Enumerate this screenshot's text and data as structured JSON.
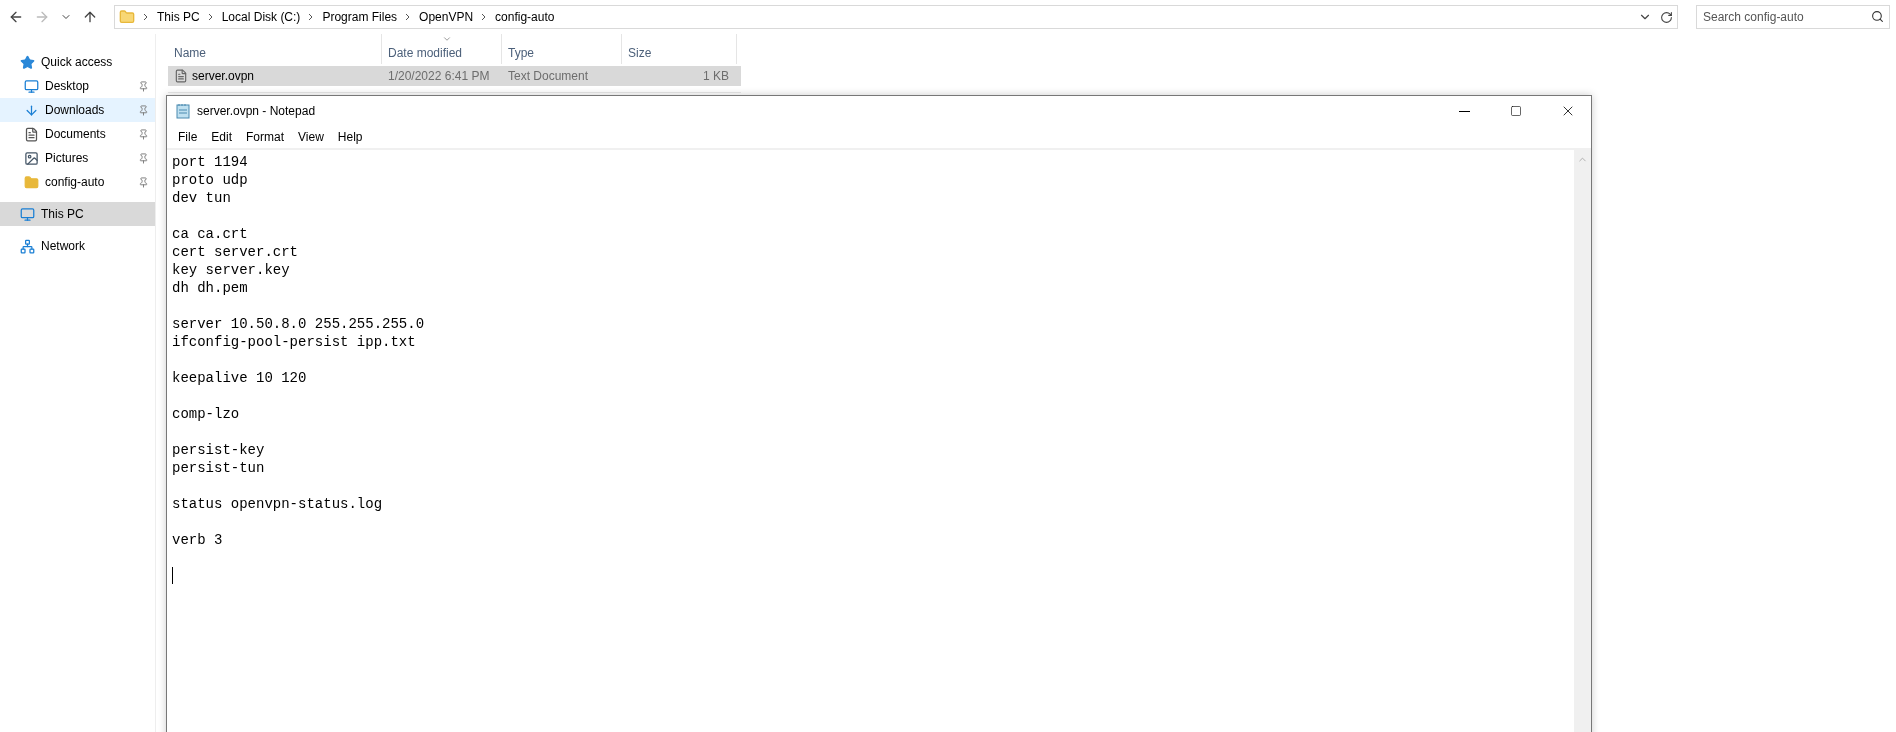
{
  "explorer": {
    "breadcrumb": [
      "This PC",
      "Local Disk (C:)",
      "Program Files",
      "OpenVPN",
      "config-auto"
    ],
    "search": {
      "placeholder": "Search config-auto"
    },
    "sidebar": [
      {
        "label": "Quick access",
        "kind": "star",
        "pinned": false,
        "selected": false,
        "highlighted": false
      },
      {
        "label": "Desktop",
        "kind": "desktop",
        "pinned": true,
        "selected": false,
        "highlighted": false
      },
      {
        "label": "Downloads",
        "kind": "download",
        "pinned": true,
        "selected": false,
        "highlighted": true
      },
      {
        "label": "Documents",
        "kind": "document",
        "pinned": true,
        "selected": false,
        "highlighted": false
      },
      {
        "label": "Pictures",
        "kind": "picture",
        "pinned": true,
        "selected": false,
        "highlighted": false
      },
      {
        "label": "config-auto",
        "kind": "folder",
        "pinned": true,
        "selected": false,
        "highlighted": false
      },
      {
        "label": "This PC",
        "kind": "pc",
        "pinned": false,
        "selected": true,
        "highlighted": false
      },
      {
        "label": "Network",
        "kind": "network",
        "pinned": false,
        "selected": false,
        "highlighted": false
      }
    ],
    "columns": [
      {
        "label": "Name",
        "sorted": false
      },
      {
        "label": "Date modified",
        "sorted": true
      },
      {
        "label": "Type",
        "sorted": false
      },
      {
        "label": "Size",
        "sorted": false
      }
    ],
    "files": [
      {
        "name": "server.ovpn",
        "date": "1/20/2022 6:41 PM",
        "type": "Text Document",
        "size": "1 KB",
        "selected": true
      }
    ]
  },
  "notepad": {
    "title": "server.ovpn - Notepad",
    "menu": [
      "File",
      "Edit",
      "Format",
      "View",
      "Help"
    ],
    "text": "port 1194\nproto udp\ndev tun\n\nca ca.crt\ncert server.crt\nkey server.key\ndh dh.pem\n\nserver 10.50.8.0 255.255.255.0\nifconfig-pool-persist ipp.txt\n\nkeepalive 10 120\n\ncomp-lzo\n\npersist-key\npersist-tun\n\nstatus openvpn-status.log\n\nverb 3\n\n"
  }
}
